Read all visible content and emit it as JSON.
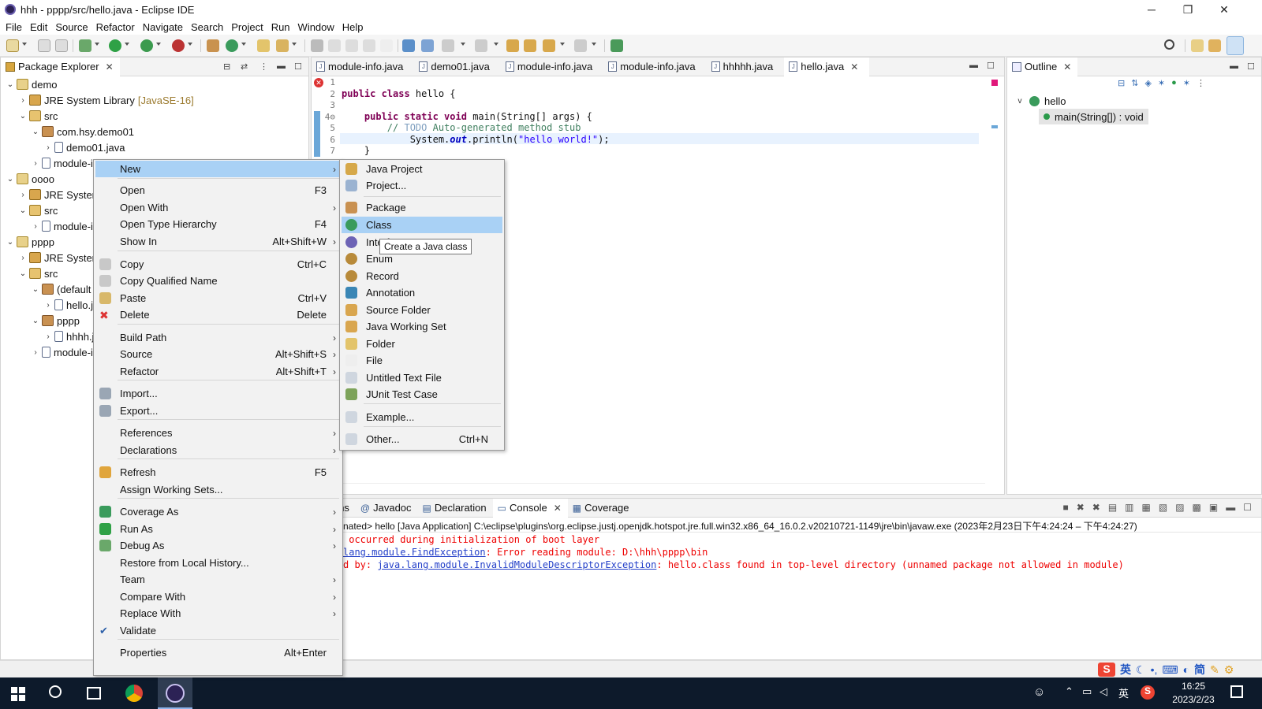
{
  "window": {
    "title": "hhh - pppp/src/hello.java - Eclipse IDE",
    "minimize": "─",
    "maximize": "❐",
    "close": "✕"
  },
  "menubar": {
    "items": [
      "File",
      "Edit",
      "Source",
      "Refactor",
      "Navigate",
      "Search",
      "Project",
      "Run",
      "Window",
      "Help"
    ]
  },
  "package_explorer": {
    "title": "Package Explorer",
    "rows": [
      {
        "indent": 0,
        "arrow": "v",
        "icon": "proj",
        "label": "demo"
      },
      {
        "indent": 1,
        "arrow": ">",
        "icon": "lib",
        "label": "JRE System Library",
        "suffix": "[JavaSE-16]"
      },
      {
        "indent": 1,
        "arrow": "v",
        "icon": "src",
        "label": "src"
      },
      {
        "indent": 2,
        "arrow": "v",
        "icon": "pkg",
        "label": "com.hsy.demo01"
      },
      {
        "indent": 3,
        "arrow": ">",
        "icon": "file",
        "label": "demo01.java"
      },
      {
        "indent": 2,
        "arrow": ">",
        "icon": "file",
        "label": "module-info.java"
      },
      {
        "indent": 0,
        "arrow": "v",
        "icon": "proj",
        "label": "oooo"
      },
      {
        "indent": 1,
        "arrow": ">",
        "icon": "lib",
        "label": "JRE System Library"
      },
      {
        "indent": 1,
        "arrow": "v",
        "icon": "src",
        "label": "src"
      },
      {
        "indent": 2,
        "arrow": ">",
        "icon": "file",
        "label": "module-info.java"
      },
      {
        "indent": 0,
        "arrow": "v",
        "icon": "proj",
        "label": "pppp"
      },
      {
        "indent": 1,
        "arrow": ">",
        "icon": "lib",
        "label": "JRE System Library"
      },
      {
        "indent": 1,
        "arrow": "v",
        "icon": "src",
        "label": "src"
      },
      {
        "indent": 2,
        "arrow": "v",
        "icon": "pkg",
        "label": "(default package)"
      },
      {
        "indent": 3,
        "arrow": ">",
        "icon": "file",
        "label": "hello.java"
      },
      {
        "indent": 2,
        "arrow": "v",
        "icon": "pkg",
        "label": "pppp"
      },
      {
        "indent": 3,
        "arrow": ">",
        "icon": "file",
        "label": "hhhh.java"
      },
      {
        "indent": 2,
        "arrow": ">",
        "icon": "file",
        "label": "module-info.java"
      }
    ]
  },
  "editor": {
    "tabs": [
      "module-info.java",
      "demo01.java",
      "module-info.java",
      "module-info.java",
      "hhhhh.java",
      "hello.java"
    ],
    "active_tab": "hello.java",
    "line_numbers": [
      "1",
      "2",
      "3",
      "4⊖",
      "5",
      "6",
      "7"
    ],
    "code": {
      "l2_kw": "public class ",
      "l2_rest": "hello {",
      "l4_kw": "public static void ",
      "l4_rest": "main(String[] args) {",
      "l5_cm": "// ",
      "l5_todo": "TODO",
      "l5_rest": " Auto-generated method stub",
      "l6_a": "System.",
      "l6_b": "out",
      "l6_c": ".println(",
      "l6_str": "\"hello world!\"",
      "l6_d": ");",
      "l7": "}"
    }
  },
  "outline": {
    "title": "Outline",
    "class_name": "hello",
    "method": "main(String[]) : void"
  },
  "context_menu": {
    "items": [
      {
        "label": "New",
        "accel": "",
        "sub": true,
        "hl": true
      },
      {
        "label": "Open",
        "accel": "F3"
      },
      {
        "label": "Open With",
        "accel": "",
        "sub": true
      },
      {
        "label": "Open Type Hierarchy",
        "accel": "F4"
      },
      {
        "label": "Show In",
        "accel": "Alt+Shift+W",
        "sub": true
      },
      {
        "label": "Copy",
        "accel": "Ctrl+C"
      },
      {
        "label": "Copy Qualified Name",
        "accel": ""
      },
      {
        "label": "Paste",
        "accel": "Ctrl+V"
      },
      {
        "label": "Delete",
        "accel": "Delete"
      },
      {
        "label": "Build Path",
        "accel": "",
        "sub": true
      },
      {
        "label": "Source",
        "accel": "Alt+Shift+S",
        "sub": true
      },
      {
        "label": "Refactor",
        "accel": "Alt+Shift+T",
        "sub": true
      },
      {
        "label": "Import...",
        "accel": ""
      },
      {
        "label": "Export...",
        "accel": ""
      },
      {
        "label": "References",
        "accel": "",
        "sub": true
      },
      {
        "label": "Declarations",
        "accel": "",
        "sub": true
      },
      {
        "label": "Refresh",
        "accel": "F5"
      },
      {
        "label": "Assign Working Sets...",
        "accel": ""
      },
      {
        "label": "Coverage As",
        "accel": "",
        "sub": true
      },
      {
        "label": "Run As",
        "accel": "",
        "sub": true
      },
      {
        "label": "Debug As",
        "accel": "",
        "sub": true
      },
      {
        "label": "Restore from Local History...",
        "accel": ""
      },
      {
        "label": "Team",
        "accel": "",
        "sub": true
      },
      {
        "label": "Compare With",
        "accel": "",
        "sub": true
      },
      {
        "label": "Replace With",
        "accel": "",
        "sub": true
      },
      {
        "label": "Validate",
        "accel": ""
      },
      {
        "label": "Properties",
        "accel": "Alt+Enter"
      }
    ]
  },
  "new_submenu": {
    "items": [
      {
        "label": "Java Project"
      },
      {
        "label": "Project..."
      },
      {
        "label": "Package"
      },
      {
        "label": "Class",
        "hl": true
      },
      {
        "label": "Interface"
      },
      {
        "label": "Enum"
      },
      {
        "label": "Record"
      },
      {
        "label": "Annotation"
      },
      {
        "label": "Source Folder"
      },
      {
        "label": "Java Working Set"
      },
      {
        "label": "Folder"
      },
      {
        "label": "File"
      },
      {
        "label": "Untitled Text File"
      },
      {
        "label": "JUnit Test Case"
      },
      {
        "label": "Example..."
      },
      {
        "label": "Other...",
        "accel": "Ctrl+N"
      }
    ],
    "tooltip": "Create a Java class"
  },
  "console": {
    "tabs": [
      "oblems",
      "Javadoc",
      "Declaration",
      "Console",
      "Coverage"
    ],
    "header": "nated> hello [Java Application] C:\\eclipse\\plugins\\org.eclipse.justj.openjdk.hotspot.jre.full.win32.x86_64_16.0.2.v20210721-1149\\jre\\bin\\javaw.exe  (2023年2月23日下午4:24:24 – 下午4:24:27)",
    "line1": " occurred during initialization of boot layer",
    "line2_link": "lang.module.FindException",
    "line2_rest": ": Error reading module: D:\\hhh\\pppp\\bin",
    "line3_pre": "d by: ",
    "line3_link": "java.lang.module.InvalidModuleDescriptorException",
    "line3_rest": ": hello.class found in top-level directory (unnamed package not allowed in module)"
  },
  "ime": {
    "items": [
      "英",
      "简"
    ]
  },
  "taskbar": {
    "time": "16:25",
    "date": "2023/2/23",
    "lang": "英"
  }
}
